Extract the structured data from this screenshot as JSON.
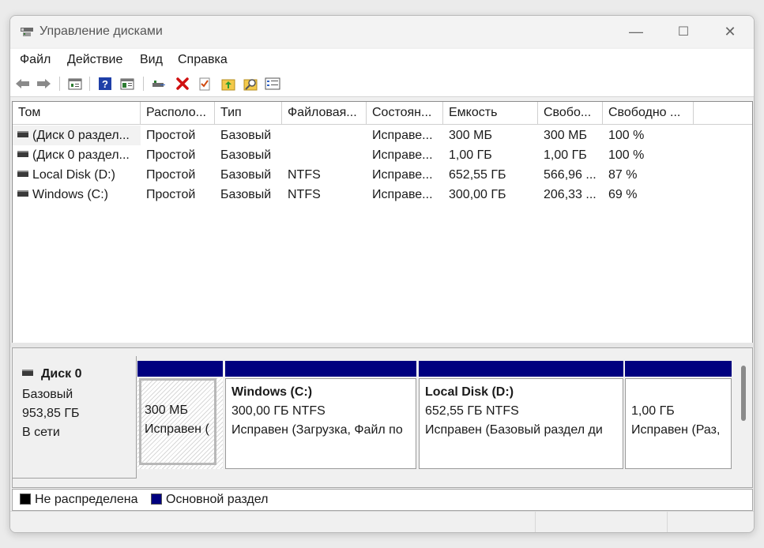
{
  "window": {
    "title": "Управление дисками",
    "controls": {
      "minimize": "—",
      "maximize": "☐",
      "close": "✕"
    }
  },
  "menu": [
    "Файл",
    "Действие",
    "Вид",
    "Справка"
  ],
  "toolbar": {
    "icons": [
      "back-icon",
      "forward-icon",
      "properties-icon",
      "help-icon",
      "view-icon",
      "connect-icon",
      "delete-icon",
      "check-icon",
      "up-icon",
      "search-icon",
      "list-icon"
    ]
  },
  "volumes": {
    "columns": [
      "Том",
      "Располо...",
      "Тип",
      "Файловая...",
      "Состоян...",
      "Емкость",
      "Свобо...",
      "Свободно ..."
    ],
    "rows": [
      [
        "(Диск 0 раздел...",
        "Простой",
        "Базовый",
        "",
        "Исправе...",
        "300 МБ",
        "300 МБ",
        "100 %"
      ],
      [
        "(Диск 0 раздел...",
        "Простой",
        "Базовый",
        "",
        "Исправе...",
        "1,00 ГБ",
        "1,00 ГБ",
        "100 %"
      ],
      [
        "Local Disk (D:)",
        "Простой",
        "Базовый",
        "NTFS",
        "Исправе...",
        "652,55 ГБ",
        "566,96 ...",
        "87 %"
      ],
      [
        "Windows (C:)",
        "Простой",
        "Базовый",
        "NTFS",
        "Исправе...",
        "300,00 ГБ",
        "206,33 ...",
        "69 %"
      ]
    ]
  },
  "disk": {
    "name": "Диск 0",
    "type": "Базовый",
    "size": "953,85 ГБ",
    "status": "В сети",
    "partitions": [
      {
        "title": "",
        "size": "300 МБ",
        "status": "Исправен ("
      },
      {
        "title": "Windows  (C:)",
        "size": "300,00 ГБ NTFS",
        "status": "Исправен (Загрузка, Файл по"
      },
      {
        "title": "Local Disk  (D:)",
        "size": "652,55 ГБ NTFS",
        "status": "Исправен (Базовый раздел ди"
      },
      {
        "title": "",
        "size": "1,00 ГБ",
        "status": "Исправен (Раз,"
      }
    ]
  },
  "legend": [
    {
      "label": "Не распределена",
      "color": "#000000"
    },
    {
      "label": "Основной раздел",
      "color": "#00007f"
    }
  ],
  "colors": {
    "primary_partition": "#00007f",
    "unallocated": "#000000",
    "delete": "#d01010"
  }
}
